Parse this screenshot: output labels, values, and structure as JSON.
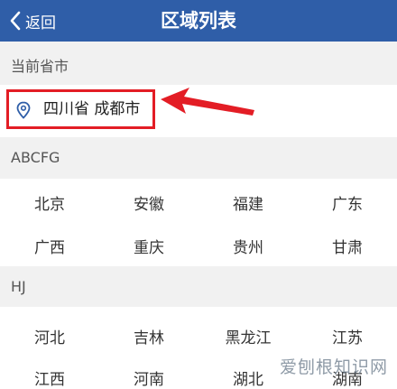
{
  "header": {
    "back_label": "返回",
    "title": "区域列表"
  },
  "current": {
    "section_label": "当前省市",
    "location": "四川省 成都市"
  },
  "groups": [
    {
      "label": "ABCFG",
      "cities": [
        "北京",
        "安徽",
        "福建",
        "广东",
        "广西",
        "重庆",
        "贵州",
        "甘肃"
      ]
    },
    {
      "label": "HJ",
      "cities": [
        "河北",
        "吉林",
        "黑龙江",
        "江苏",
        "江西",
        "河南",
        "湖北",
        "湖南"
      ]
    }
  ],
  "watermark": "爱刨根知识网",
  "colors": {
    "header_bg": "#2f5ea8",
    "highlight": "#e31d25",
    "section_bg": "#f1f1f1"
  }
}
